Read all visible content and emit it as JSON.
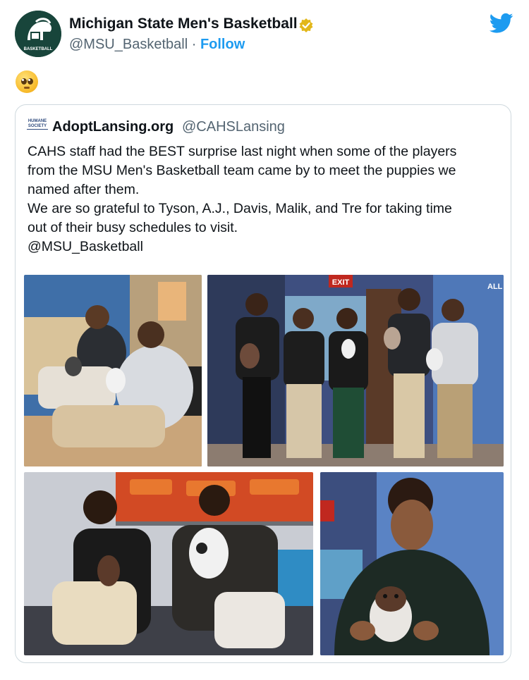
{
  "header": {
    "display_name": "Michigan State Men's Basketball",
    "handle": "@MSU_Basketball",
    "separator": " · ",
    "follow_label": "Follow",
    "avatar_label": "BASKETBALL"
  },
  "tweet_emoji": "pleading-face",
  "quoted_tweet": {
    "avatar_text": "HUMANE SOCIETY",
    "display_name": "AdoptLansing.org",
    "handle": "@CAHSLansing",
    "lines": [
      "CAHS staff had the BEST surprise last night when some of the players",
      "from the MSU Men's Basketball team came by to meet the puppies we",
      "named after them.",
      "We are so grateful to Tyson, A.J., Davis, Malik, and Tre for taking time",
      "out of their busy schedules to visit.",
      "@MSU_Basketball"
    ],
    "photo_signs": {
      "exit": "EXIT",
      "wall_text": "ALL L"
    }
  },
  "colors": {
    "link": "#1d9bf0",
    "msu_green": "#18453b",
    "verified_gold": "#e2b719"
  }
}
